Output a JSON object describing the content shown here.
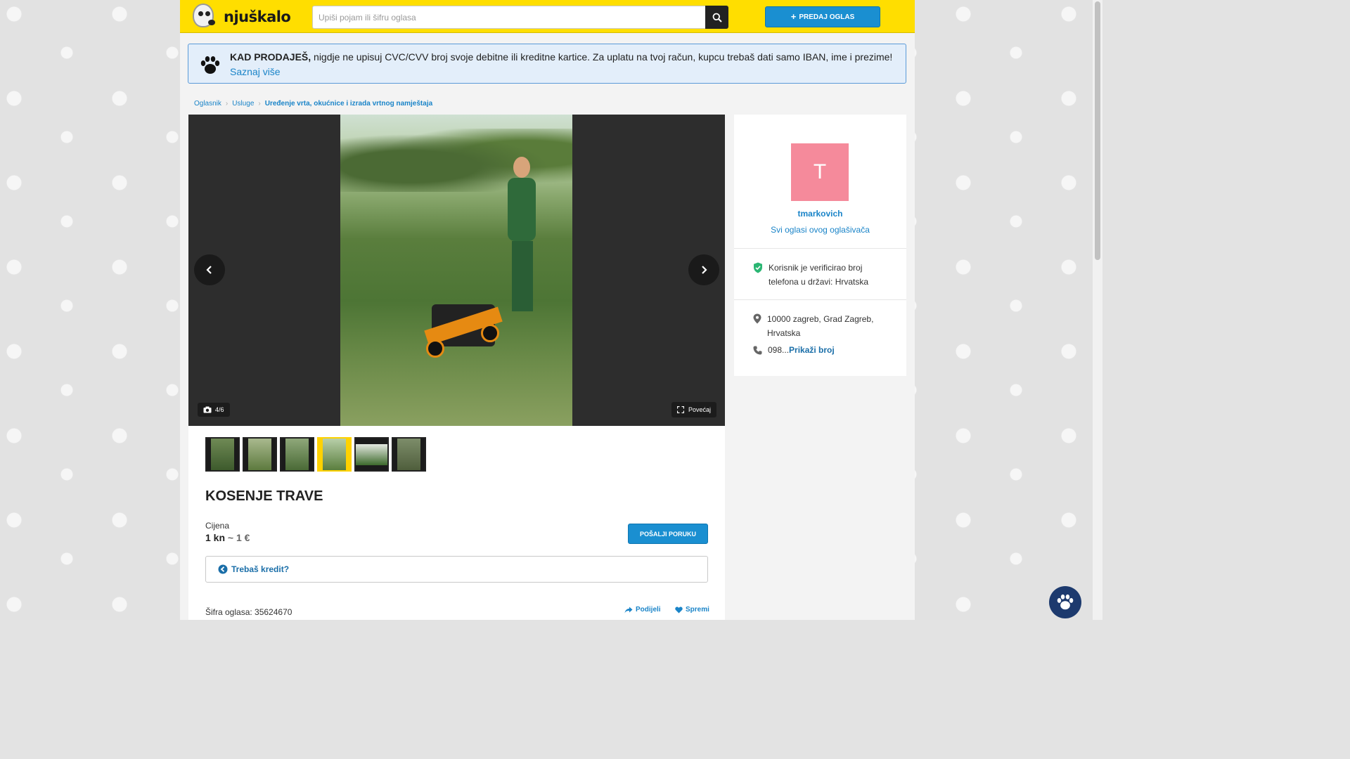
{
  "header": {
    "logo_text": "njuškalo",
    "search_placeholder": "Upiši pojam ili šifru oglasa",
    "sell_button": "PREDAJ OGLAS"
  },
  "notice": {
    "bold": "KAD PRODAJEŠ,",
    "text": " nigdje ne upisuj CVC/CVV broj svoje debitne ili kreditne kartice. Za uplatu na tvoj račun, kupcu trebaš dati samo IBAN, ime i prezime!",
    "more": "Saznaj više"
  },
  "breadcrumb": [
    "Oglasnik",
    "Usluge",
    "Uređenje vrta, okućnice i izrada vrtnog namještaja"
  ],
  "gallery": {
    "counter": "4/6",
    "enlarge": "Povećaj",
    "thumb_count": 6,
    "active_thumb": 4
  },
  "ad": {
    "title": "KOSENJE TRAVE",
    "price_label": "Cijena",
    "price_kn": "1 kn",
    "price_sep": " ~ ",
    "price_eur": "1 €",
    "send_message": "POŠALJI PORUKU",
    "credit": "Trebaš kredit?",
    "ad_code": "Šifra oglasa: 35624670",
    "share": "Podijeli",
    "save": "Spremi"
  },
  "seller": {
    "avatar_letter": "T",
    "name": "tmarkovich",
    "all_ads": "Svi oglasi ovog oglašivača",
    "verified": "Korisnik je verificirao broj telefona u državi: Hrvatska",
    "location": "10000 zagreb, Grad Zagreb, Hrvatska",
    "phone_prefix": "098...",
    "phone_show": "Prikaži broj"
  },
  "colors": {
    "header_yellow": "#ffde00",
    "link_blue": "#1a84c8",
    "button_blue": "#1a8fd1",
    "avatar_pink": "#f58a9b",
    "verified_green": "#2bb673"
  }
}
